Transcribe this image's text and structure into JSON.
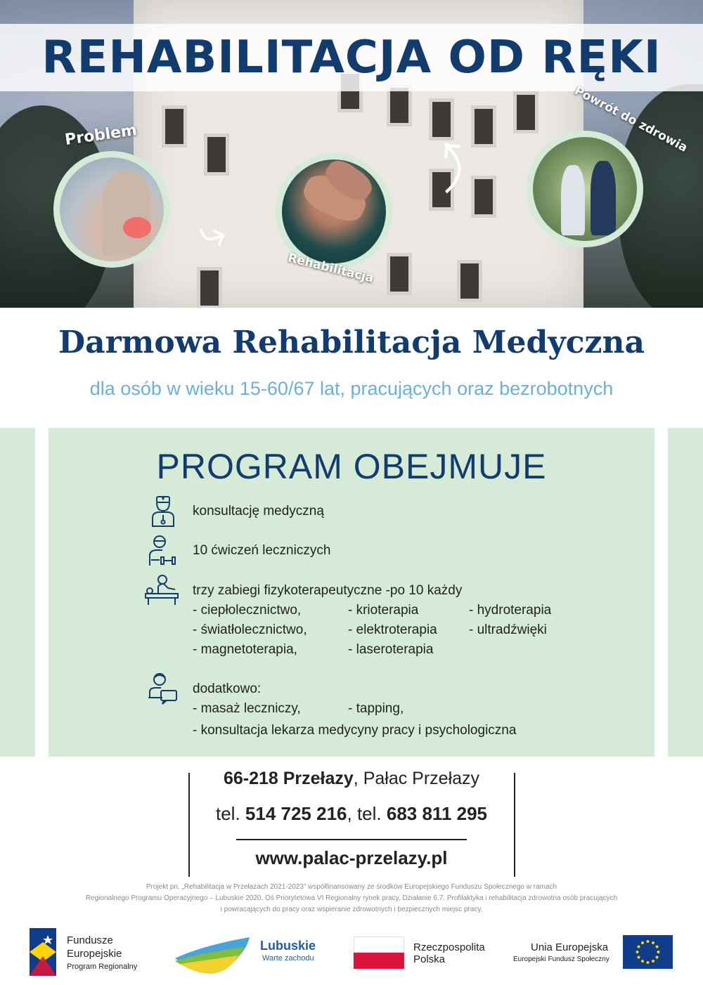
{
  "hero": {
    "title": "REHABILITACJA OD RĘKI",
    "step1": "Problem",
    "step2": "Rehabilitacja",
    "step3": "Powrót do zdrowia"
  },
  "headline": "Darmowa Rehabilitacja Medyczna",
  "subline": "dla osób w wieku  15-60/67 lat,  pracujących oraz bezrobotnych",
  "program": {
    "title": "PROGRAM OBEJMUJE",
    "items": [
      {
        "icon": "doctor-icon",
        "text": "konsultację medyczną"
      },
      {
        "icon": "exercise-icon",
        "text": "10 ćwiczeń leczniczych"
      },
      {
        "icon": "treatment-bed-icon",
        "text": "trzy zabiegi fizykoterapeutyczne -po 10  każdy"
      },
      {
        "icon": "consultation-icon",
        "text": "dodatkowo:"
      }
    ],
    "treatments": [
      [
        "- ciepłolecznictwo,",
        "- krioterapia",
        "- hydroterapia"
      ],
      [
        "- światłolecznictwo,",
        "- elektroterapia",
        "- ultradźwięki"
      ],
      [
        "- magnetoterapia,",
        "- laseroterapia",
        ""
      ]
    ],
    "extras": {
      "a": "- masaż leczniczy,",
      "b": "- tapping,",
      "c": "- konsultacja lekarza medycyny pracy i psychologiczna"
    }
  },
  "contact": {
    "postal": "66-218 Przełazy",
    "place": ", Pałac Przełazy",
    "tel_label1": "tel. ",
    "tel1": "514 725 216",
    "tel_label2": ", tel. ",
    "tel2": "683 811 295",
    "website": "www.palac-przelazy.pl"
  },
  "footnote": {
    "line1": "Projekt pn. „Rehabilitacja w Przełazach 2021-2023” współfinansowany ze środków Europejskiego Funduszu Społecznego w ramach",
    "line2": "Regionalnego Programu Operacyjnego – Lubuskie 2020, Oś Priorytetowa VI Regionalny rynek pracy, Działanie 6.7. Profilaktyka i rehabilitacja zdrowotna osób pracujących",
    "line3": "i powracających do pracy oraz wspieranie zdrowotnych i bezpiecznych miejsc pracy."
  },
  "logos": {
    "fe_line1": "Fundusze",
    "fe_line2": "Europejskie",
    "fe_line3": "Program Regionalny",
    "lubuskie_name": "Lubuskie",
    "lubuskie_tagline": "Warte zachodu",
    "rp_line1": "Rzeczpospolita",
    "rp_line2": "Polska",
    "ue_line1": "Unia Europejska",
    "ue_line2": "Europejski Fundusz Społeczny"
  },
  "colors": {
    "navy": "#123c6e",
    "light_blue": "#6ab0d9",
    "mint": "#d5ebd8",
    "eu_blue": "#0f3d8c",
    "eu_star": "#ffd500",
    "pl_red": "#dc143c"
  }
}
